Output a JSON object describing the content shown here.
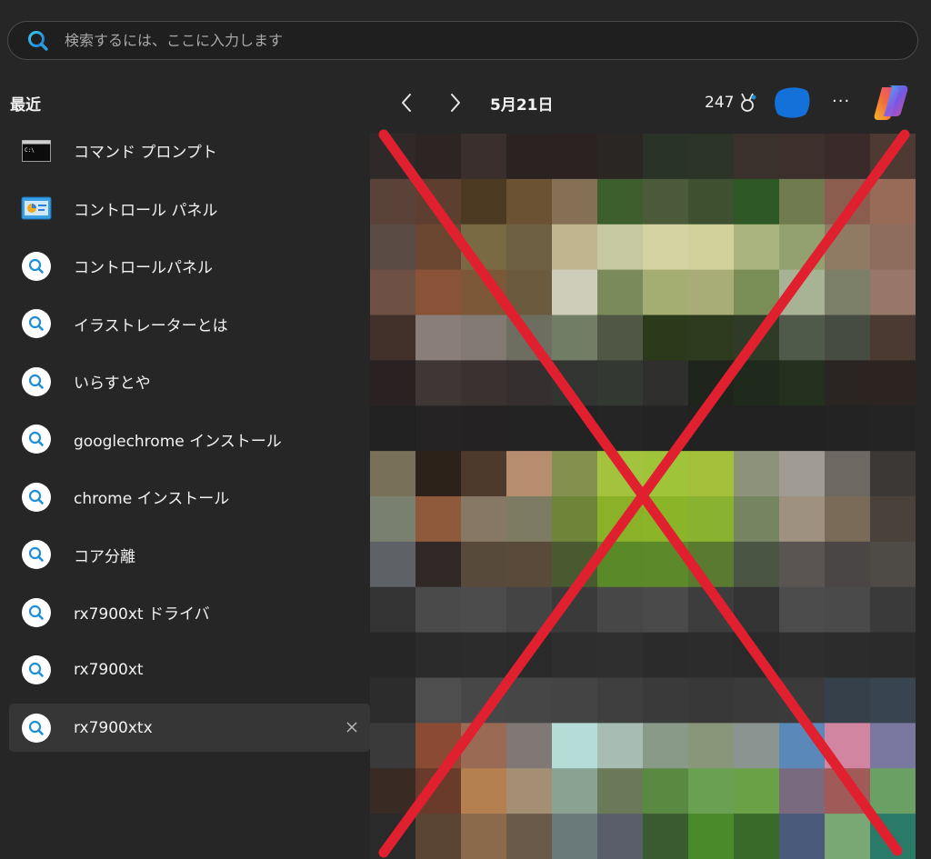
{
  "search": {
    "placeholder": "検索するには、ここに入力します",
    "value": ""
  },
  "recent": {
    "title": "最近",
    "items": [
      {
        "label": "コマンド プロンプト",
        "icon": "command-prompt-icon"
      },
      {
        "label": "コントロール パネル",
        "icon": "control-panel-icon"
      },
      {
        "label": "コントロールパネル",
        "icon": "search-icon"
      },
      {
        "label": "イラストレーターとは",
        "icon": "search-icon"
      },
      {
        "label": "いらすとや",
        "icon": "search-icon"
      },
      {
        "label": "googlechrome インストール",
        "icon": "search-icon"
      },
      {
        "label": "chrome インストール",
        "icon": "search-icon"
      },
      {
        "label": "コア分離",
        "icon": "search-icon"
      },
      {
        "label": "rx7900xt ドライバ",
        "icon": "search-icon"
      },
      {
        "label": "rx7900xt",
        "icon": "search-icon"
      },
      {
        "label": "rx7900xtx",
        "icon": "search-icon",
        "selected": true,
        "remove_icon": "close-icon"
      }
    ]
  },
  "header": {
    "prev_icon": "chevron-left-icon",
    "next_icon": "chevron-right-icon",
    "date": "5月21日",
    "points": "247",
    "points_icon": "rewards-medal-icon",
    "more_label": "···",
    "copilot_icon": "copilot-icon"
  },
  "content": {
    "image": "pixelated-image",
    "overlay": "red-cross",
    "colors": {
      "cross": "#e0202f",
      "accent": "#1e8fd6",
      "background": "#262626"
    }
  }
}
